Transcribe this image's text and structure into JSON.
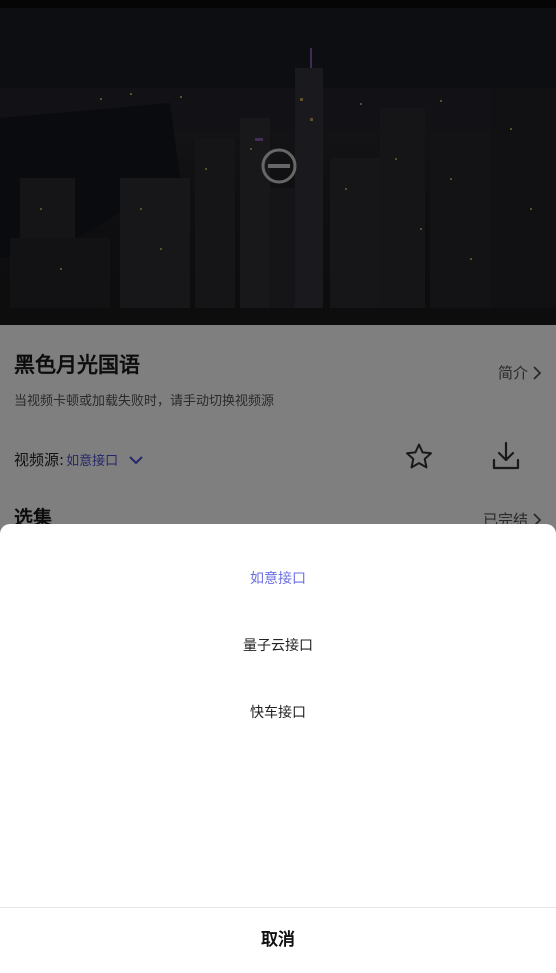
{
  "player": {
    "status": "loading",
    "spinner_icon": "loading-spinner-icon"
  },
  "video": {
    "title": "黑色月光国语",
    "tip": "当视频卡顿或加载失败时，请手动切换视频源",
    "intro_label": "简介"
  },
  "source": {
    "label": "视频源:",
    "current": "如意接口"
  },
  "icons": {
    "favorite": "star-icon",
    "download": "download-icon"
  },
  "episodes": {
    "title": "选集",
    "status": "已完结"
  },
  "source_sheet": {
    "options": [
      {
        "label": "如意接口",
        "selected": true
      },
      {
        "label": "量子云接口",
        "selected": false
      },
      {
        "label": "快车接口",
        "selected": false
      }
    ],
    "cancel_label": "取消"
  },
  "colors": {
    "accent": "#6b6fe0",
    "source_value": "#4b4fd0",
    "overlay": "rgba(0,0,0,0.5)"
  }
}
